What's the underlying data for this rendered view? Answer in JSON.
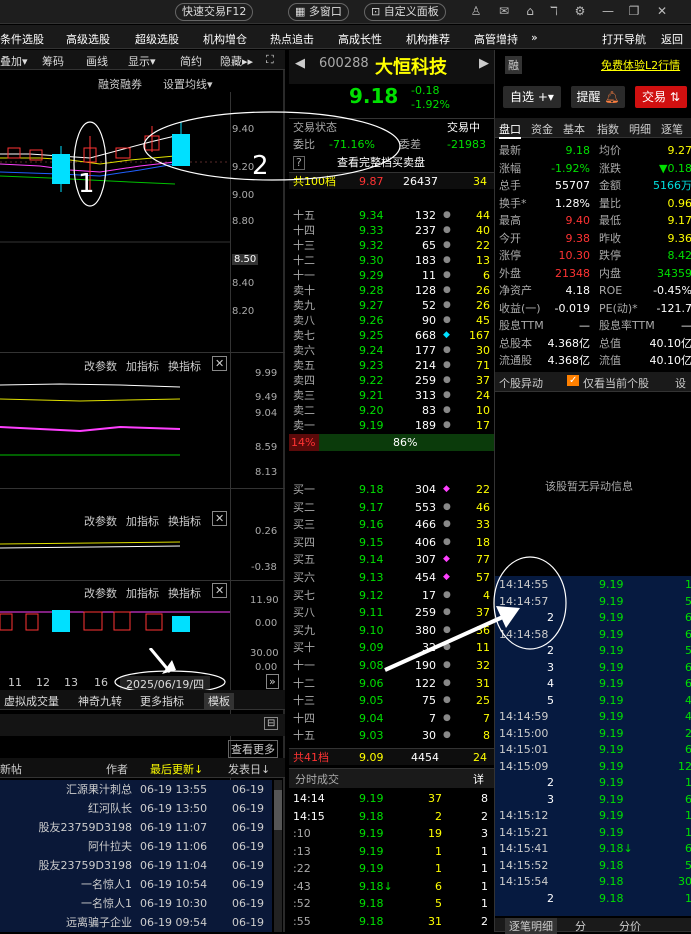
{
  "titlebar": {
    "quick_trade": "快速交易F12",
    "multi_window": "多窗口",
    "custom_panel": "自定义面板"
  },
  "menu": [
    "条件选股",
    "高级选股",
    "超级选股",
    "机构增仓",
    "热点追击",
    "高成长性",
    "机构推荐",
    "高管增持",
    "»",
    "打开导航",
    "返回"
  ],
  "left": {
    "toolbar": [
      "叠加▾",
      "筹码",
      "画线",
      "显示▾",
      "简约",
      "隐藏▸▸"
    ],
    "chart_header": [
      "融资融券",
      "设置均线▾"
    ],
    "price_ticks": [
      "9.40",
      "9.20",
      "9.00",
      "8.80",
      "8.50",
      "8.40",
      "8.20"
    ],
    "annotation_1": "1",
    "panel2": {
      "buttons": [
        "改参数",
        "加指标",
        "换指标"
      ],
      "ticks": [
        "9.99",
        "9.49",
        "9.04",
        "8.59",
        "8.13"
      ]
    },
    "panel3": {
      "buttons": [
        "改参数",
        "加指标",
        "换指标"
      ],
      "ticks": [
        "0.26",
        "-0.38"
      ]
    },
    "panel4": {
      "buttons": [
        "改参数",
        "加指标",
        "换指标"
      ],
      "ticks": [
        "11.90",
        "0.00",
        "30.00",
        "0.00"
      ]
    },
    "dates": [
      "11",
      "12",
      "13",
      "16"
    ],
    "date_cursor": "2025/06/19/四",
    "bottom_tabs": [
      "虚拟成交量",
      "神奇九转",
      "更多指标",
      "模板"
    ],
    "forum": {
      "view_more": "查看更多",
      "new_post": "新帖",
      "author": "作者",
      "latest": "最后更新↓",
      "post_date": "发表日↓",
      "rows": [
        {
          "author": "汇源果汁刺总",
          "time": "06-19 13:55",
          "date": "06-19"
        },
        {
          "author": "红河队长",
          "time": "06-19 13:50",
          "date": "06-19"
        },
        {
          "author": "股友23759D3198",
          "time": "06-19 11:07",
          "date": "06-19"
        },
        {
          "author": "阿什拉夫",
          "time": "06-19 11:06",
          "date": "06-19"
        },
        {
          "author": "股友23759D3198",
          "time": "06-19 11:04",
          "date": "06-19"
        },
        {
          "author": "一名惊人1",
          "time": "06-19 10:54",
          "date": "06-19"
        },
        {
          "author": "一名惊人1",
          "time": "06-19 10:30",
          "date": "06-19"
        },
        {
          "author": "远离骗子企业",
          "time": "06-19 09:54",
          "date": "06-19"
        }
      ]
    }
  },
  "mid": {
    "code": "600288",
    "name": "大恒科技",
    "price": "9.18",
    "change": "-0.18",
    "pct": "-1.92%",
    "trade_status_label": "交易状态",
    "trade_status": "交易中",
    "webi_label": "委比",
    "webi": "-71.16%",
    "weicha_label": "委差",
    "weicha": "-21983",
    "view_full": "查看完整档买卖盘",
    "sell_total": {
      "label": "共100档",
      "price": "9.87",
      "vol": "26437",
      "count": "34"
    },
    "asks": [
      {
        "l": "十五",
        "p": "9.34",
        "v": "132",
        "c": "44"
      },
      {
        "l": "十四",
        "p": "9.33",
        "v": "237",
        "c": "40"
      },
      {
        "l": "十三",
        "p": "9.32",
        "v": "65",
        "c": "22"
      },
      {
        "l": "十二",
        "p": "9.30",
        "v": "183",
        "c": "13"
      },
      {
        "l": "十一",
        "p": "9.29",
        "v": "11",
        "c": "6"
      },
      {
        "l": "卖十",
        "p": "9.28",
        "v": "128",
        "c": "26"
      },
      {
        "l": "卖九",
        "p": "9.27",
        "v": "52",
        "c": "26"
      },
      {
        "l": "卖八",
        "p": "9.26",
        "v": "90",
        "c": "45"
      },
      {
        "l": "卖七",
        "p": "9.25",
        "v": "668",
        "c": "167"
      },
      {
        "l": "卖六",
        "p": "9.24",
        "v": "177",
        "c": "30"
      },
      {
        "l": "卖五",
        "p": "9.23",
        "v": "214",
        "c": "71"
      },
      {
        "l": "卖四",
        "p": "9.22",
        "v": "259",
        "c": "37"
      },
      {
        "l": "卖三",
        "p": "9.21",
        "v": "313",
        "c": "24"
      },
      {
        "l": "卖二",
        "p": "9.20",
        "v": "83",
        "c": "10"
      },
      {
        "l": "卖一",
        "p": "9.19",
        "v": "189",
        "c": "17"
      }
    ],
    "ratio_left": "14%",
    "ratio_right": "86%",
    "bids": [
      {
        "l": "买一",
        "p": "9.18",
        "v": "304",
        "c": "22"
      },
      {
        "l": "买二",
        "p": "9.17",
        "v": "553",
        "c": "46"
      },
      {
        "l": "买三",
        "p": "9.16",
        "v": "466",
        "c": "33"
      },
      {
        "l": "买四",
        "p": "9.15",
        "v": "406",
        "c": "18"
      },
      {
        "l": "买五",
        "p": "9.14",
        "v": "307",
        "c": "77"
      },
      {
        "l": "买六",
        "p": "9.13",
        "v": "454",
        "c": "57"
      },
      {
        "l": "买七",
        "p": "9.12",
        "v": "17",
        "c": "4"
      },
      {
        "l": "买八",
        "p": "9.11",
        "v": "259",
        "c": "37"
      },
      {
        "l": "买九",
        "p": "9.10",
        "v": "380",
        "c": "36"
      },
      {
        "l": "买十",
        "p": "9.09",
        "v": "32",
        "c": "11"
      },
      {
        "l": "十一",
        "p": "9.08",
        "v": "190",
        "c": "32"
      },
      {
        "l": "十二",
        "p": "9.06",
        "v": "122",
        "c": "31"
      },
      {
        "l": "十三",
        "p": "9.05",
        "v": "75",
        "c": "25"
      },
      {
        "l": "十四",
        "p": "9.04",
        "v": "7",
        "c": "7"
      },
      {
        "l": "十五",
        "p": "9.03",
        "v": "30",
        "c": "8"
      }
    ],
    "buy_total": {
      "label": "共41档",
      "price": "9.09",
      "vol": "4454",
      "count": "24"
    },
    "ticks_label": "分时成交",
    "ticks_detail": "详",
    "ticks": [
      {
        "t": "14:14",
        "p": "9.19",
        "v": "37",
        "n": "8"
      },
      {
        "t": "14:15",
        "p": "9.18",
        "v": "2",
        "n": "2"
      },
      {
        "t": ":10",
        "p": "9.19",
        "v": "19",
        "n": "3"
      },
      {
        "t": ":13",
        "p": "9.19",
        "v": "1",
        "n": "1"
      },
      {
        "t": ":22",
        "p": "9.19",
        "v": "1",
        "n": "1"
      },
      {
        "t": ":43",
        "p": "9.18↓",
        "v": "6",
        "n": "1"
      },
      {
        "t": ":52",
        "p": "9.18",
        "v": "5",
        "n": "1"
      },
      {
        "t": ":55",
        "p": "9.18",
        "v": "31",
        "n": "2"
      }
    ]
  },
  "right": {
    "rong": "融",
    "l2": "免费体验L2行情",
    "zixuan": "自选",
    "tixing": "提醒",
    "jiaoyi": "交易",
    "tabs": [
      "盘口",
      "资金",
      "基本",
      "指数",
      "明细",
      "逐笔"
    ],
    "stats": [
      [
        "最新",
        "9.18",
        "均价",
        "9.27"
      ],
      [
        "涨幅",
        "-1.92%",
        "涨跌",
        "▼0.18"
      ],
      [
        "总手",
        "55707",
        "金额",
        "5166万"
      ],
      [
        "换手*",
        "1.28%",
        "量比",
        "0.96"
      ],
      [
        "最高",
        "9.40",
        "最低",
        "9.17"
      ],
      [
        "今开",
        "9.38",
        "昨收",
        "9.36"
      ],
      [
        "涨停",
        "10.30",
        "跌停",
        "8.42"
      ],
      [
        "外盘",
        "21348",
        "内盘",
        "34359"
      ],
      [
        "净资产",
        "4.18",
        "ROE",
        "-0.45%"
      ],
      [
        "收益(一)",
        "-0.019",
        "PE(动)*",
        "-121.7"
      ],
      [
        "股息TTM",
        "—",
        "股息率TTM",
        "—"
      ],
      [
        "总股本",
        "4.368亿",
        "总值",
        "40.10亿"
      ],
      [
        "流通股",
        "4.368亿",
        "流值",
        "40.10亿"
      ]
    ],
    "anomaly_label": "个股异动",
    "only_current": "仅看当前个股",
    "settings": "设",
    "anomaly_empty": "该股暂无异动信息",
    "trades": [
      {
        "t": "14:14:55",
        "p": "9.19",
        "v": "1"
      },
      {
        "t": "14:14:57",
        "p": "9.19",
        "v": "5"
      },
      {
        "t": "2",
        "p": "9.19",
        "v": "6"
      },
      {
        "t": "14:14:58",
        "p": "9.19",
        "v": "6"
      },
      {
        "t": "2",
        "p": "9.19",
        "v": "5"
      },
      {
        "t": "3",
        "p": "9.19",
        "v": "6"
      },
      {
        "t": "4",
        "p": "9.19",
        "v": "6"
      },
      {
        "t": "5",
        "p": "9.19",
        "v": "4"
      },
      {
        "t": "14:14:59",
        "p": "9.19",
        "v": "4"
      },
      {
        "t": "14:15:00",
        "p": "9.19",
        "v": "2"
      },
      {
        "t": "14:15:01",
        "p": "9.19",
        "v": "6"
      },
      {
        "t": "14:15:09",
        "p": "9.19",
        "v": "12"
      },
      {
        "t": "2",
        "p": "9.19",
        "v": "1"
      },
      {
        "t": "3",
        "p": "9.19",
        "v": "6"
      },
      {
        "t": "14:15:12",
        "p": "9.19",
        "v": "1"
      },
      {
        "t": "14:15:21",
        "p": "9.19",
        "v": "1"
      },
      {
        "t": "14:15:41",
        "p": "9.18↓",
        "v": "6"
      },
      {
        "t": "14:15:52",
        "p": "9.18",
        "v": "5"
      },
      {
        "t": "14:15:54",
        "p": "9.18",
        "v": "30"
      },
      {
        "t": "2",
        "p": "9.18",
        "v": "1"
      }
    ],
    "bottom_tabs": [
      "逐笔明细",
      "分",
      "分价"
    ]
  },
  "annotation_2": "2"
}
